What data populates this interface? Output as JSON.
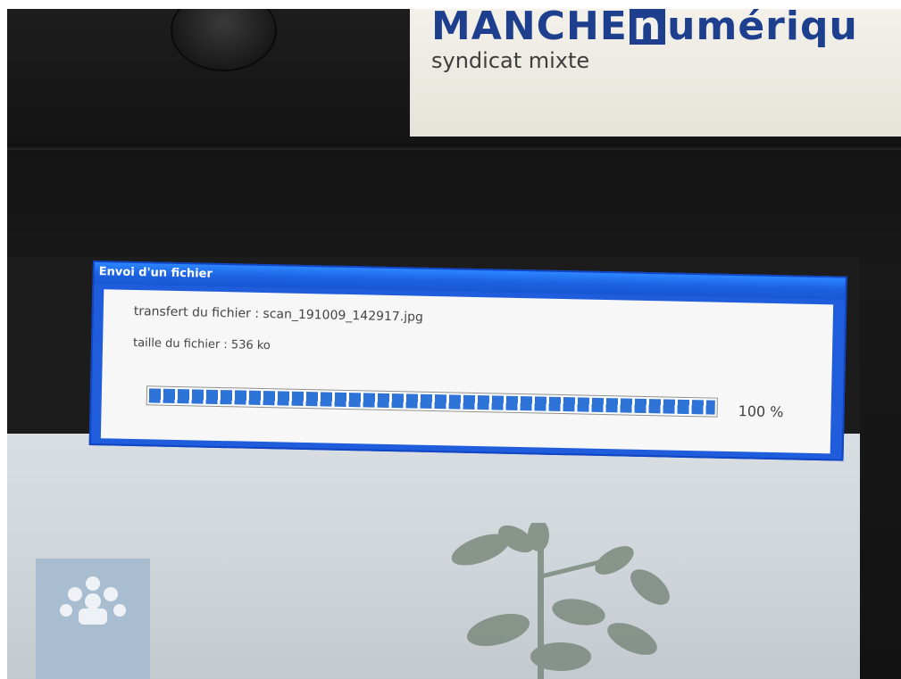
{
  "brand": {
    "name_left": "MANCHE",
    "name_n": "n",
    "name_right": "umériqu",
    "subtitle": "syndicat mixte"
  },
  "dialog": {
    "title": "Envoi d'un fichier",
    "transfer_line": "transfert du fichier : scan_191009_142917.jpg",
    "size_line": "taille du fichier : 536 ko",
    "progress_percent": 100,
    "progress_label": "100 %"
  },
  "colors": {
    "brand_blue": "#1d3f8e",
    "title_bar": "#1c63e2",
    "progress_blue": "#2d73d8"
  }
}
